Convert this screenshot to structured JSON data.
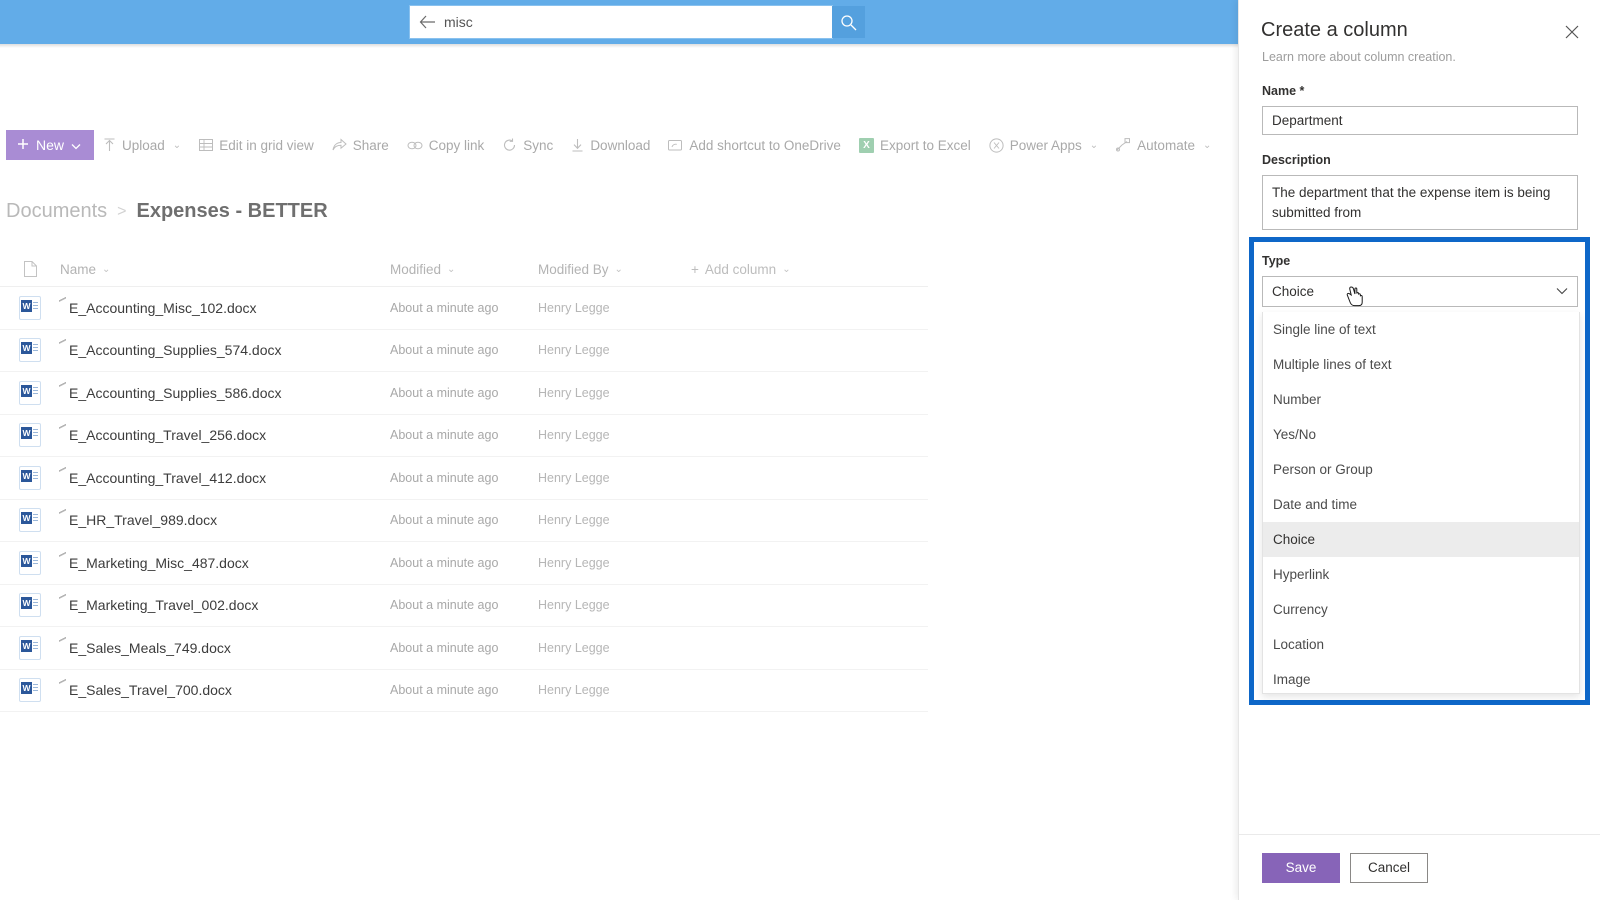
{
  "search": {
    "value": "misc",
    "placeholder": "Search",
    "back_icon": "back-arrow-icon",
    "search_icon": "search-icon"
  },
  "toolbar": {
    "new_label": "New",
    "items": [
      {
        "label": "Upload",
        "icon": "upload-icon",
        "chevron": true
      },
      {
        "label": "Edit in grid view",
        "icon": "grid-icon",
        "chevron": false
      },
      {
        "label": "Share",
        "icon": "share-icon",
        "chevron": false
      },
      {
        "label": "Copy link",
        "icon": "link-icon",
        "chevron": false
      },
      {
        "label": "Sync",
        "icon": "sync-icon",
        "chevron": false
      },
      {
        "label": "Download",
        "icon": "download-icon",
        "chevron": false
      },
      {
        "label": "Add shortcut to OneDrive",
        "icon": "onedrive-shortcut-icon",
        "chevron": false
      },
      {
        "label": "Export to Excel",
        "icon": "excel-icon",
        "chevron": false
      },
      {
        "label": "Power Apps",
        "icon": "power-apps-icon",
        "chevron": true
      },
      {
        "label": "Automate",
        "icon": "automate-icon",
        "chevron": true
      }
    ]
  },
  "breadcrumb": {
    "root": "Documents",
    "separator": ">",
    "current": "Expenses - BETTER"
  },
  "file_list": {
    "columns": [
      "Name",
      "Modified",
      "Modified By"
    ],
    "add_column_label": "Add column",
    "rows": [
      {
        "name": "E_Accounting_Misc_102.docx",
        "modified": "About a minute ago",
        "modified_by": "Henry Legge"
      },
      {
        "name": "E_Accounting_Supplies_574.docx",
        "modified": "About a minute ago",
        "modified_by": "Henry Legge"
      },
      {
        "name": "E_Accounting_Supplies_586.docx",
        "modified": "About a minute ago",
        "modified_by": "Henry Legge"
      },
      {
        "name": "E_Accounting_Travel_256.docx",
        "modified": "About a minute ago",
        "modified_by": "Henry Legge"
      },
      {
        "name": "E_Accounting_Travel_412.docx",
        "modified": "About a minute ago",
        "modified_by": "Henry Legge"
      },
      {
        "name": "E_HR_Travel_989.docx",
        "modified": "About a minute ago",
        "modified_by": "Henry Legge"
      },
      {
        "name": "E_Marketing_Misc_487.docx",
        "modified": "About a minute ago",
        "modified_by": "Henry Legge"
      },
      {
        "name": "E_Marketing_Travel_002.docx",
        "modified": "About a minute ago",
        "modified_by": "Henry Legge"
      },
      {
        "name": "E_Sales_Meals_749.docx",
        "modified": "About a minute ago",
        "modified_by": "Henry Legge"
      },
      {
        "name": "E_Sales_Travel_700.docx",
        "modified": "About a minute ago",
        "modified_by": "Henry Legge"
      }
    ]
  },
  "panel": {
    "title": "Create a column",
    "subtitle": "Learn more about column creation.",
    "close_icon": "close-icon",
    "name_label": "Name *",
    "name_value": "Department",
    "description_label": "Description",
    "description_value": "The department that the expense item is being submitted from",
    "type_label": "Type",
    "type_selected": "Choice",
    "type_options": [
      "Single line of text",
      "Multiple lines of text",
      "Number",
      "Yes/No",
      "Person or Group",
      "Date and time",
      "Choice",
      "Hyperlink",
      "Currency",
      "Location",
      "Image"
    ],
    "save_label": "Save",
    "cancel_label": "Cancel"
  },
  "colors": {
    "topbar_blue": "#62ace8",
    "new_button_purple": "#a98cd4",
    "save_button_purple": "#8764b8",
    "highlight_blue": "#0e67c8",
    "excel_green": "#9fcfb0"
  }
}
